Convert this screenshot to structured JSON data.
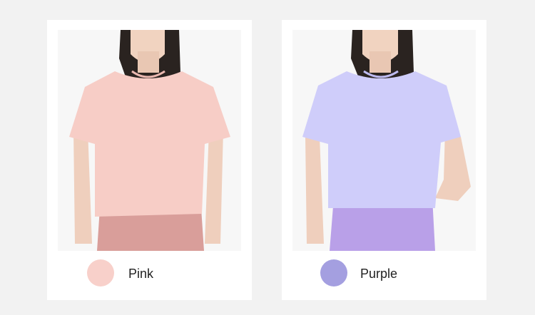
{
  "variants": [
    {
      "label": "Pink",
      "swatch_color": "#f8d0ca",
      "shirt_color": "#f7cdc6",
      "pants_color": "#d99e9a"
    },
    {
      "label": "Purple",
      "swatch_color": "#a49fe0",
      "shirt_color": "#cfcdfa",
      "pants_color": "#b9a0e8"
    }
  ]
}
